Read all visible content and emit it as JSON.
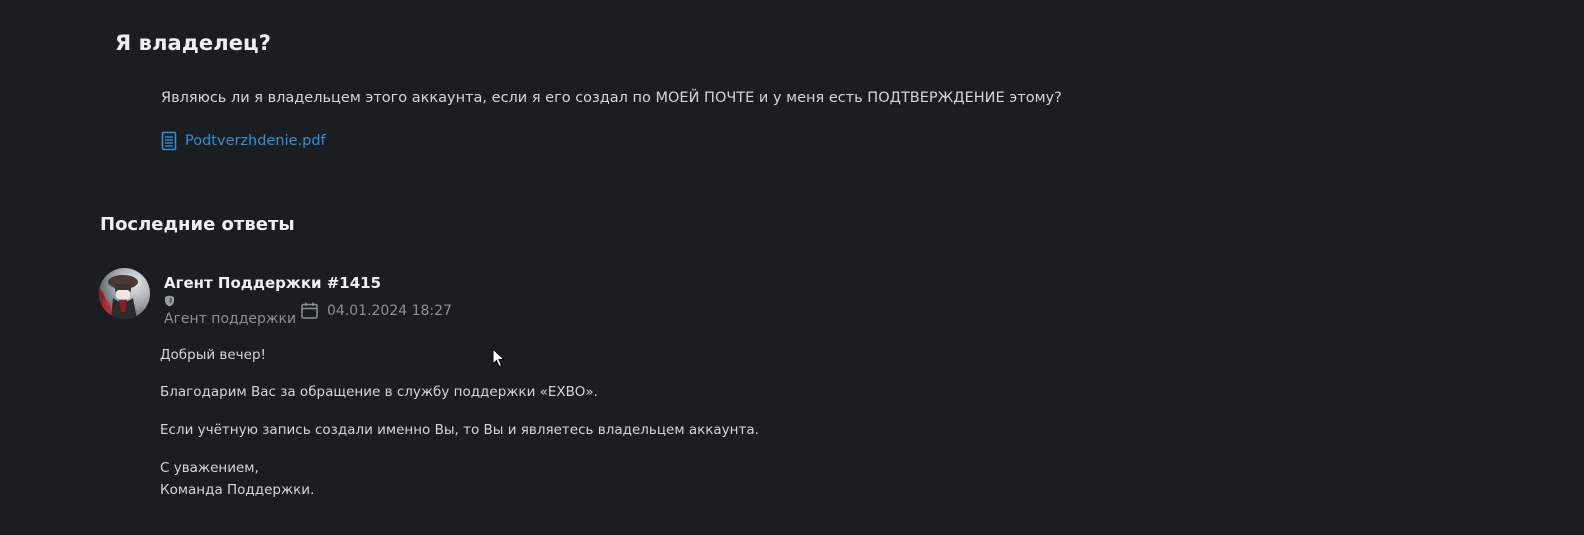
{
  "ticket": {
    "title": "Я владелец?",
    "question": "Являюсь ли я владельцем этого аккаунта, если я его создал по МОЕЙ ПОЧТЕ и у меня есть ПОДТВЕРЖДЕНИЕ этому?",
    "attachment": {
      "name": "Podtverzhdenie.pdf",
      "icon": "document-icon"
    }
  },
  "replies": {
    "title": "Последние ответы",
    "items": [
      {
        "author": "Агент Поддержки #1415",
        "role": "Агент поддержки",
        "badge_icon": "shield-icon",
        "date": "04.01.2024 18:27",
        "date_icon": "calendar-icon",
        "lines": {
          "greeting": "Добрый вечер!",
          "thanks": "Благодарим Вас за обращение в службу поддержки «EXBO».",
          "answer": "Если учётную запись создали именно Вы, то Вы и являетесь владельцем аккаунта.",
          "regards": "С уважением,",
          "signature": "Команда Поддержки."
        }
      }
    ]
  },
  "colors": {
    "background": "#1b1e20",
    "link": "#2f8fd8",
    "muted": "#8a8f94",
    "heading": "#eef0f2"
  }
}
